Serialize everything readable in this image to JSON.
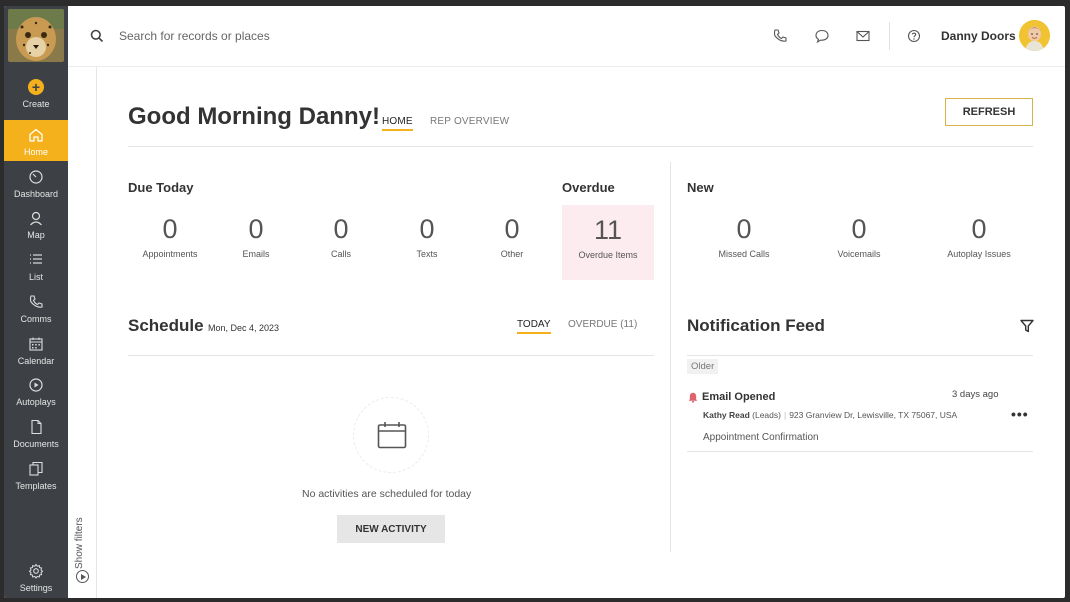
{
  "sidebar": {
    "create_label": "Create",
    "items": [
      {
        "label": "Home",
        "icon": "home-icon",
        "active": true
      },
      {
        "label": "Dashboard",
        "icon": "dashboard-icon"
      },
      {
        "label": "Map",
        "icon": "map-pin-icon"
      },
      {
        "label": "List",
        "icon": "list-icon"
      },
      {
        "label": "Comms",
        "icon": "phone-icon"
      },
      {
        "label": "Calendar",
        "icon": "calendar-icon"
      },
      {
        "label": "Autoplays",
        "icon": "autoplay-icon"
      },
      {
        "label": "Documents",
        "icon": "document-icon"
      },
      {
        "label": "Templates",
        "icon": "templates-icon"
      }
    ],
    "settings_label": "Settings"
  },
  "filters": {
    "label": "Show filters"
  },
  "topbar": {
    "search_placeholder": "Search for records or places",
    "user_name": "Danny Doors"
  },
  "header": {
    "greeting": "Good Morning Danny!",
    "tabs": [
      "HOME",
      "REP OVERVIEW"
    ],
    "refresh_label": "REFRESH"
  },
  "due_today": {
    "title": "Due Today",
    "stats": [
      {
        "value": "0",
        "label": "Appointments"
      },
      {
        "value": "0",
        "label": "Emails"
      },
      {
        "value": "0",
        "label": "Calls"
      },
      {
        "value": "0",
        "label": "Texts"
      },
      {
        "value": "0",
        "label": "Other"
      }
    ]
  },
  "overdue": {
    "title": "Overdue",
    "value": "11",
    "label": "Overdue Items"
  },
  "new_section": {
    "title": "New",
    "stats": [
      {
        "value": "0",
        "label": "Missed Calls"
      },
      {
        "value": "0",
        "label": "Voicemails"
      },
      {
        "value": "0",
        "label": "Autoplay Issues"
      }
    ]
  },
  "schedule": {
    "title": "Schedule",
    "date": "Mon, Dec 4, 2023",
    "tabs": [
      "TODAY",
      "OVERDUE (11)"
    ],
    "empty_text": "No activities are scheduled for today",
    "new_activity_label": "NEW ACTIVITY"
  },
  "notification_feed": {
    "title": "Notification Feed",
    "group_label": "Older",
    "items": [
      {
        "title": "Email Opened",
        "time": "3 days ago",
        "contact": "Kathy Read",
        "contact_type": "(Leads)",
        "address": "923 Granview Dr, Lewisville, TX 75067, USA",
        "detail": "Appointment Confirmation"
      }
    ]
  },
  "colors": {
    "accent": "#f4b11c",
    "sidebar": "#3d4145",
    "overdue_bg": "#fdecef",
    "notification_bell": "#e0626e"
  }
}
